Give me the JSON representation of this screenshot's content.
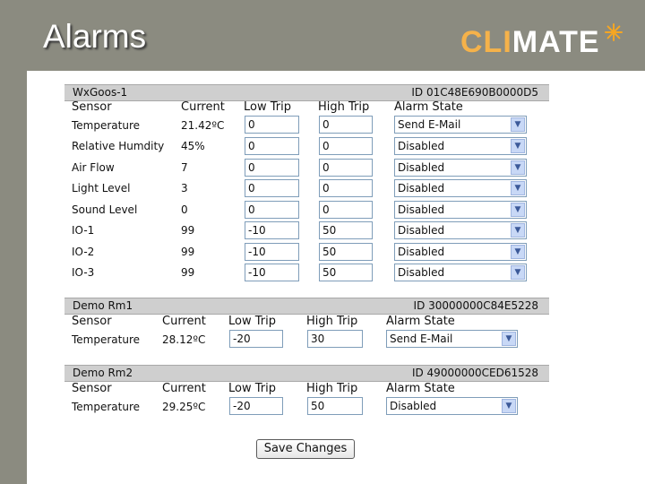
{
  "slide_title": "Alarms",
  "logo": {
    "part1": "CLI",
    "part2": "MATE"
  },
  "columns": {
    "sensor": "Sensor",
    "current": "Current",
    "low": "Low Trip",
    "high": "High Trip",
    "state": "Alarm State"
  },
  "save_label": "Save Changes",
  "sections": [
    {
      "name": "WxGoos-1",
      "id": "ID 01C48E690B0000D5",
      "rows": [
        {
          "sensor": "Temperature",
          "current": "21.42ºC",
          "low": "0",
          "high": "0",
          "state": "Send E-Mail"
        },
        {
          "sensor": "Relative Humdity",
          "current": "45%",
          "low": "0",
          "high": "0",
          "state": "Disabled"
        },
        {
          "sensor": "Air Flow",
          "current": "7",
          "low": "0",
          "high": "0",
          "state": "Disabled"
        },
        {
          "sensor": "Light Level",
          "current": "3",
          "low": "0",
          "high": "0",
          "state": "Disabled"
        },
        {
          "sensor": "Sound Level",
          "current": "0",
          "low": "0",
          "high": "0",
          "state": "Disabled"
        },
        {
          "sensor": "IO-1",
          "current": "99",
          "low": "-10",
          "high": "50",
          "state": "Disabled"
        },
        {
          "sensor": "IO-2",
          "current": "99",
          "low": "-10",
          "high": "50",
          "state": "Disabled"
        },
        {
          "sensor": "IO-3",
          "current": "99",
          "low": "-10",
          "high": "50",
          "state": "Disabled"
        }
      ]
    },
    {
      "name": "Demo Rm1",
      "id": "ID 30000000C84E5228",
      "rows": [
        {
          "sensor": "Temperature",
          "current": "28.12ºC",
          "low": "-20",
          "high": "30",
          "state": "Send E-Mail"
        }
      ]
    },
    {
      "name": "Demo Rm2",
      "id": "ID 49000000CED61528",
      "rows": [
        {
          "sensor": "Temperature",
          "current": "29.25ºC",
          "low": "-20",
          "high": "50",
          "state": "Disabled"
        }
      ]
    }
  ]
}
